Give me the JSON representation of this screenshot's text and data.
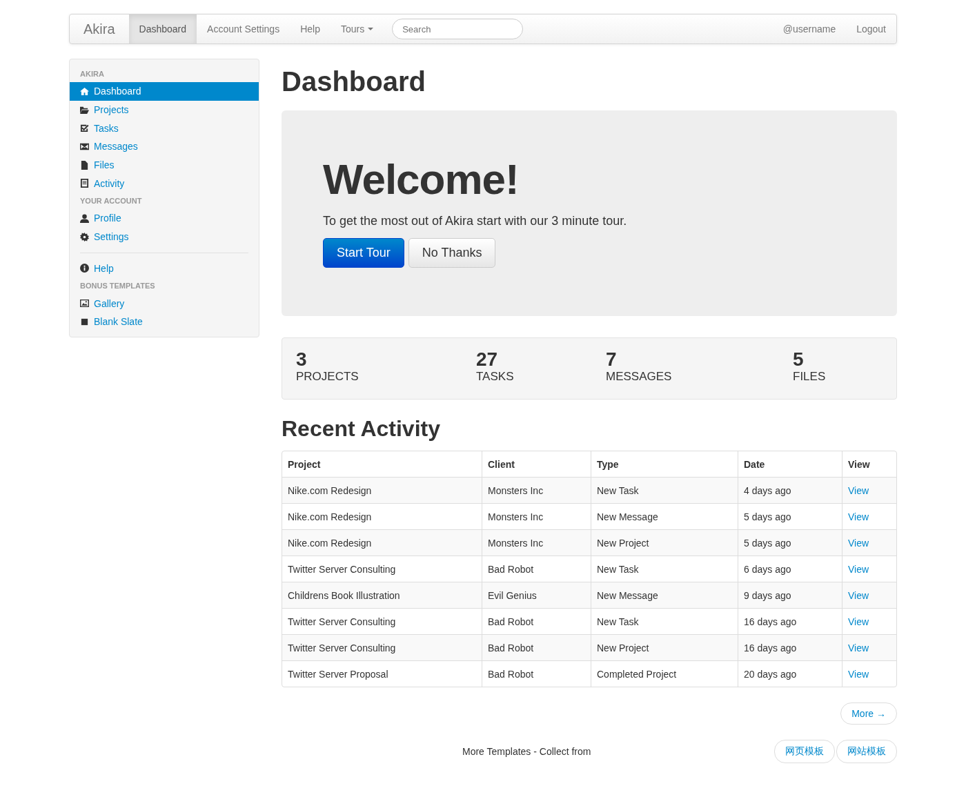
{
  "navbar": {
    "brand": "Akira",
    "items": [
      {
        "label": "Dashboard",
        "selected": true,
        "dropdown": false
      },
      {
        "label": "Account Settings",
        "selected": false,
        "dropdown": false
      },
      {
        "label": "Help",
        "selected": false,
        "dropdown": false
      },
      {
        "label": "Tours",
        "selected": false,
        "dropdown": true
      }
    ],
    "search": {
      "placeholder": "Search"
    },
    "user": "@username",
    "logout": "Logout"
  },
  "sidebar": {
    "entries": [
      {
        "kind": "header",
        "label": "AKIRA"
      },
      {
        "kind": "item",
        "label": "Dashboard",
        "selected": true
      },
      {
        "kind": "item",
        "label": "Projects",
        "selected": false
      },
      {
        "kind": "item",
        "label": "Tasks",
        "selected": false
      },
      {
        "kind": "item",
        "label": "Messages",
        "selected": false
      },
      {
        "kind": "item",
        "label": "Files",
        "selected": false
      },
      {
        "kind": "item",
        "label": "Activity",
        "selected": false
      },
      {
        "kind": "header",
        "label": "YOUR ACCOUNT"
      },
      {
        "kind": "item",
        "label": "Profile",
        "selected": false
      },
      {
        "kind": "item",
        "label": "Settings",
        "selected": false
      },
      {
        "kind": "divider"
      },
      {
        "kind": "item",
        "label": "Help",
        "selected": false
      },
      {
        "kind": "header",
        "label": "BONUS TEMPLATES"
      },
      {
        "kind": "item",
        "label": "Gallery",
        "selected": false
      },
      {
        "kind": "item",
        "label": "Blank Slate",
        "selected": false
      }
    ]
  },
  "page_title": "Dashboard",
  "welcome": {
    "heading": "Welcome!",
    "text": "To get the most out of Akira start with our 3 minute tour.",
    "buttons": [
      {
        "label": "Start Tour",
        "kind": "primary"
      },
      {
        "label": "No Thanks",
        "kind": "default"
      }
    ]
  },
  "stats": [
    {
      "count": "3",
      "label": "PROJECTS"
    },
    {
      "count": "27",
      "label": "TASKS"
    },
    {
      "count": "7",
      "label": "MESSAGES"
    },
    {
      "count": "5",
      "label": "FILES"
    }
  ],
  "recent_activity": {
    "title": "Recent Activity",
    "columns": [
      "Project",
      "Client",
      "Type",
      "Date",
      "View"
    ],
    "rows": [
      [
        "Nike.com Redesign",
        "Monsters Inc",
        "New Task",
        "4 days ago",
        "View"
      ],
      [
        "Nike.com Redesign",
        "Monsters Inc",
        "New Message",
        "5 days ago",
        "View"
      ],
      [
        "Nike.com Redesign",
        "Monsters Inc",
        "New Project",
        "5 days ago",
        "View"
      ],
      [
        "Twitter Server Consulting",
        "Bad Robot",
        "New Task",
        "6 days ago",
        "View"
      ],
      [
        "Childrens Book Illustration",
        "Evil Genius",
        "New Message",
        "9 days ago",
        "View"
      ],
      [
        "Twitter Server Consulting",
        "Bad Robot",
        "New Task",
        "16 days ago",
        "View"
      ],
      [
        "Twitter Server Consulting",
        "Bad Robot",
        "New Project",
        "16 days ago",
        "View"
      ],
      [
        "Twitter Server Proposal",
        "Bad Robot",
        "Completed Project",
        "20 days ago",
        "View"
      ]
    ],
    "more": "More →"
  },
  "footer": {
    "text": "More Templates - Collect from",
    "buttons": [
      "网页模板",
      "网站模板"
    ]
  }
}
